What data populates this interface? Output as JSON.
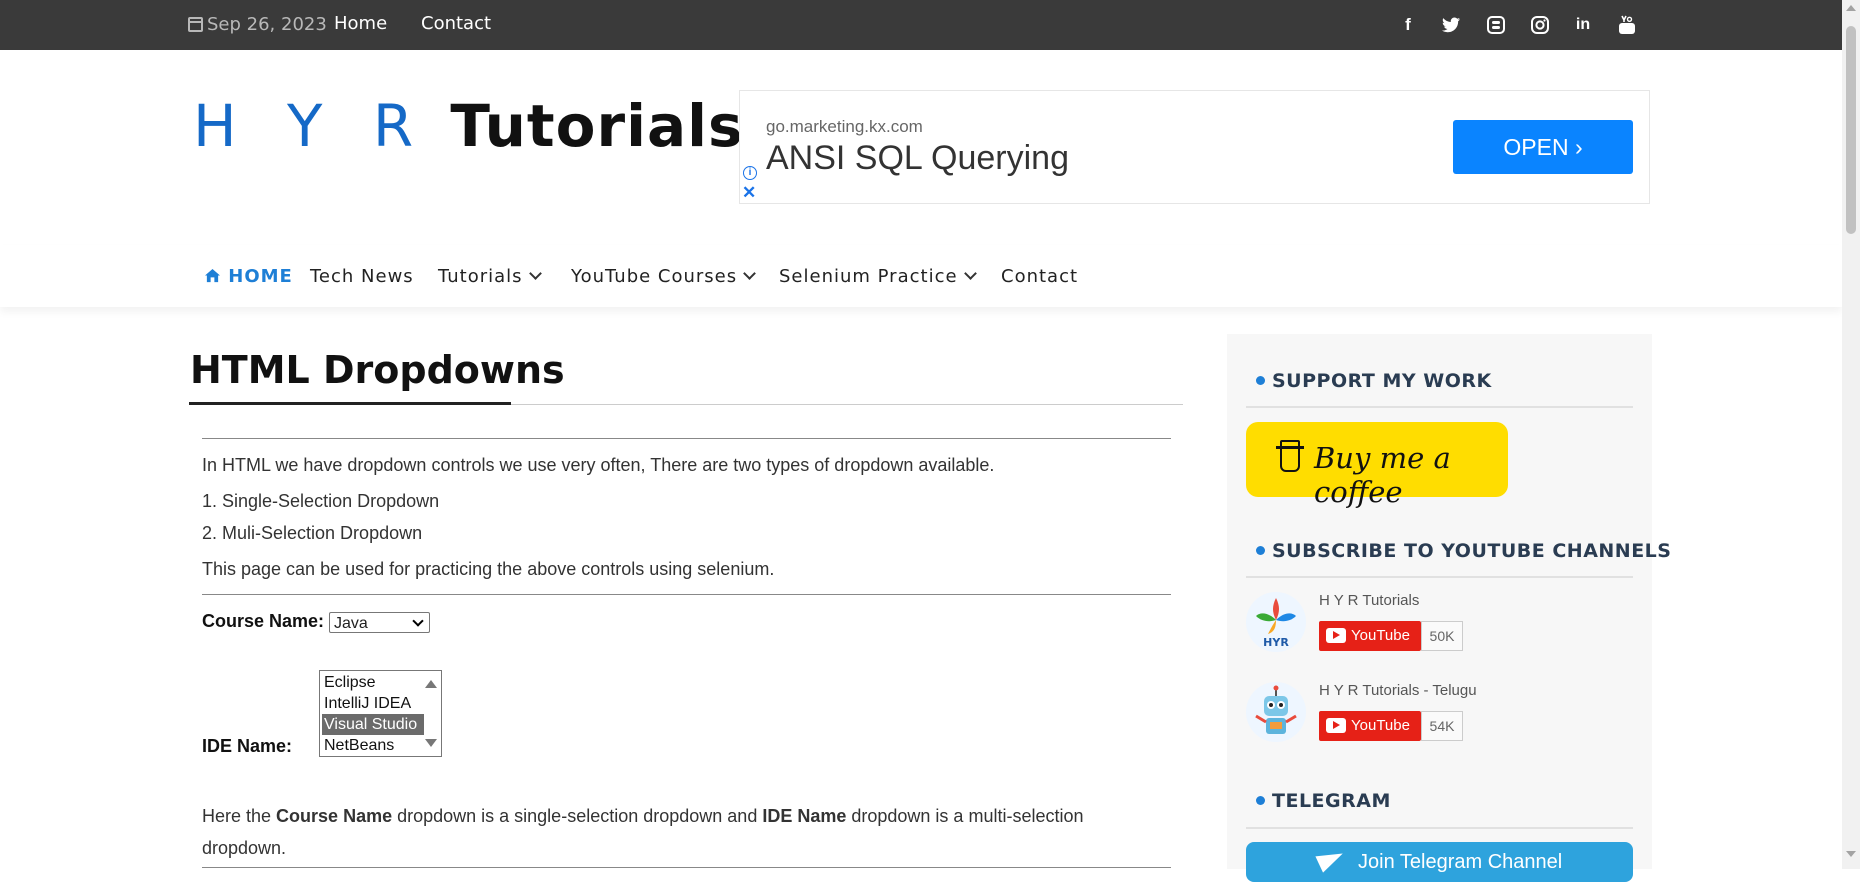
{
  "topbar": {
    "date": "Sep 26, 2023",
    "links": [
      "Home",
      "Contact"
    ],
    "social_icons": [
      "facebook-icon",
      "twitter-icon",
      "blogger-icon",
      "instagram-icon",
      "linkedin-icon",
      "youtube-icon"
    ]
  },
  "logo": {
    "part1": "H Y R",
    "part2": "Tutorials"
  },
  "ad": {
    "url": "go.marketing.kx.com",
    "title": "ANSI SQL Querying",
    "button": "OPEN ›"
  },
  "nav": {
    "home": "HOME",
    "items": [
      "Tech News",
      "Tutorials",
      "YouTube Courses",
      "Selenium Practice",
      "Contact"
    ]
  },
  "main": {
    "title": "HTML Dropdowns",
    "intro": "In HTML we have dropdown controls we use very often, There are two types of dropdown available.",
    "item1": "1. Single-Selection Dropdown",
    "item2": "2. Muli-Selection Dropdown",
    "practice": "This page can be used for practicing the above controls using selenium.",
    "course_label": "Course Name:",
    "course_value": "Java",
    "ide_label": "IDE Name:",
    "ide_options": [
      "Eclipse",
      "IntelliJ IDEA",
      "Visual Studio",
      "NetBeans"
    ],
    "ide_selected": "Visual Studio",
    "desc": {
      "p1": "Here the ",
      "b1": "Course Name",
      "p2": " dropdown is a single-selection dropdown and ",
      "b2": "IDE Name",
      "p3": " dropdown is a multi-selection",
      "p4": "dropdown."
    }
  },
  "sidebar": {
    "support_title": "SUPPORT MY WORK",
    "coffee_label": "Buy me a coffee",
    "subscribe_title": "SUBSCRIBE TO YOUTUBE CHANNELS",
    "channels": [
      {
        "name": "H Y R Tutorials",
        "button": "YouTube",
        "count": "50K",
        "avatar_text": "HYR"
      },
      {
        "name": "H Y R Tutorials - Telugu",
        "button": "YouTube",
        "count": "54K"
      }
    ],
    "telegram_title": "TELEGRAM",
    "telegram_button": "Join Telegram Channel"
  },
  "colors": {
    "accent": "#1e7fd6",
    "topbar": "#3a3a3a",
    "coffee": "#ffdd00",
    "youtube": "#e62117",
    "telegram": "#2ea3dd",
    "ad_button": "#0a84ff"
  }
}
